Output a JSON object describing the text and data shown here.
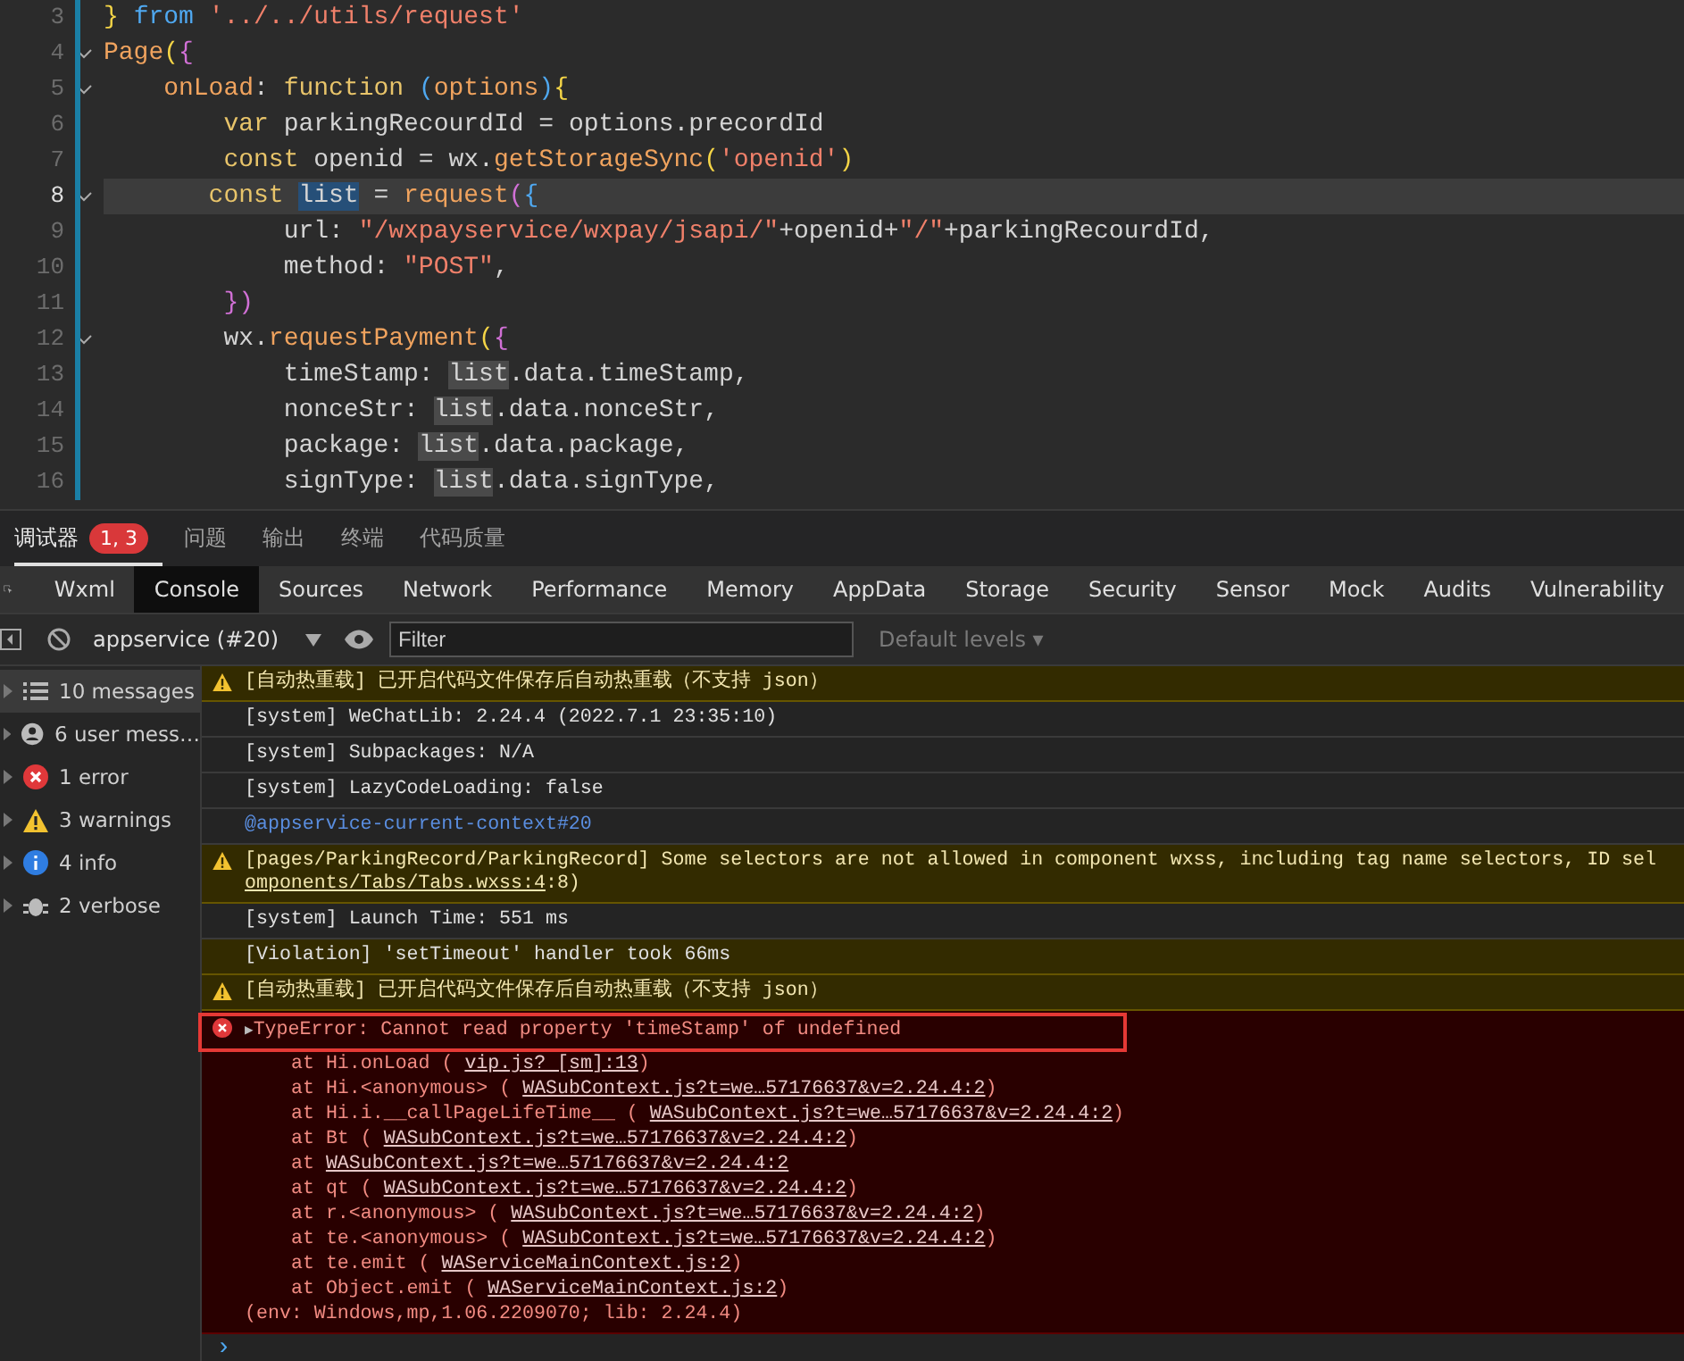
{
  "editor": {
    "lines": [
      {
        "num": "3",
        "fold": false,
        "current": false,
        "tokens": [
          {
            "t": "} ",
            "kind": "brace"
          },
          {
            "t": "from",
            "kind": "kw2"
          },
          {
            "t": " '../../utils/request'",
            "kind": "str"
          }
        ]
      },
      {
        "num": "4",
        "fold": true,
        "current": false,
        "tokens": [
          {
            "t": "Page",
            "kind": "fn"
          },
          {
            "t": "(",
            "kind": "brace"
          },
          {
            "t": "{",
            "kind": "brace2"
          }
        ]
      },
      {
        "num": "5",
        "fold": true,
        "current": false,
        "tokens": [
          {
            "t": "    onLoad",
            "kind": "fn"
          },
          {
            "t": ": ",
            "kind": "plain"
          },
          {
            "t": "function",
            "kind": "kw"
          },
          {
            "t": " (",
            "kind": "paren"
          },
          {
            "t": "options",
            "kind": "fn"
          },
          {
            "t": ")",
            "kind": "paren"
          },
          {
            "t": "{",
            "kind": "brace"
          }
        ]
      },
      {
        "num": "6",
        "fold": false,
        "current": false,
        "tokens": [
          {
            "t": "        var",
            "kind": "kw"
          },
          {
            "t": " parkingRecourdId = options.precordId",
            "kind": "plain"
          }
        ]
      },
      {
        "num": "7",
        "fold": false,
        "current": false,
        "tokens": [
          {
            "t": "        const",
            "kind": "kw"
          },
          {
            "t": " openid = wx.",
            "kind": "plain"
          },
          {
            "t": "getStorageSync",
            "kind": "fn"
          },
          {
            "t": "(",
            "kind": "brace"
          },
          {
            "t": "'openid'",
            "kind": "str"
          },
          {
            "t": ")",
            "kind": "brace"
          }
        ]
      },
      {
        "num": "8",
        "fold": true,
        "current": true,
        "tokens": [
          {
            "t": "       const ",
            "kind": "kw"
          },
          {
            "t": "list",
            "kind": "selected"
          },
          {
            "t": " = ",
            "kind": "plain"
          },
          {
            "t": "request",
            "kind": "fn"
          },
          {
            "t": "(",
            "kind": "brace2"
          },
          {
            "t": "{",
            "kind": "paren"
          }
        ]
      },
      {
        "num": "9",
        "fold": false,
        "current": false,
        "tokens": [
          {
            "t": "            url: ",
            "kind": "plain"
          },
          {
            "t": "\"/wxpayservice/wxpay/jsapi/\"",
            "kind": "str"
          },
          {
            "t": "+openid+",
            "kind": "plain"
          },
          {
            "t": "\"/\"",
            "kind": "str"
          },
          {
            "t": "+parkingRecourdId,",
            "kind": "plain"
          }
        ]
      },
      {
        "num": "10",
        "fold": false,
        "current": false,
        "tokens": [
          {
            "t": "            method: ",
            "kind": "plain"
          },
          {
            "t": "\"POST\"",
            "kind": "str"
          },
          {
            "t": ",",
            "kind": "plain"
          }
        ]
      },
      {
        "num": "11",
        "fold": false,
        "current": false,
        "tokens": [
          {
            "t": "        })",
            "kind": "brace2"
          }
        ]
      },
      {
        "num": "12",
        "fold": true,
        "current": false,
        "tokens": [
          {
            "t": "        wx.",
            "kind": "plain"
          },
          {
            "t": "requestPayment",
            "kind": "fn"
          },
          {
            "t": "(",
            "kind": "brace"
          },
          {
            "t": "{",
            "kind": "brace2"
          }
        ]
      },
      {
        "num": "13",
        "fold": false,
        "current": false,
        "tokens": [
          {
            "t": "            timeStamp: ",
            "kind": "plain"
          },
          {
            "t": "list",
            "kind": "match"
          },
          {
            "t": ".data.timeStamp,",
            "kind": "plain"
          }
        ]
      },
      {
        "num": "14",
        "fold": false,
        "current": false,
        "tokens": [
          {
            "t": "            nonceStr: ",
            "kind": "plain"
          },
          {
            "t": "list",
            "kind": "match"
          },
          {
            "t": ".data.nonceStr,",
            "kind": "plain"
          }
        ]
      },
      {
        "num": "15",
        "fold": false,
        "current": false,
        "tokens": [
          {
            "t": "            package: ",
            "kind": "plain"
          },
          {
            "t": "list",
            "kind": "match"
          },
          {
            "t": ".data.package,",
            "kind": "plain"
          }
        ]
      },
      {
        "num": "16",
        "fold": false,
        "current": false,
        "tokens": [
          {
            "t": "            signType: ",
            "kind": "plain"
          },
          {
            "t": "list",
            "kind": "match"
          },
          {
            "t": ".data.signType,",
            "kind": "plain"
          }
        ]
      }
    ]
  },
  "panel_tabs": [
    {
      "label": "调试器",
      "selected": true,
      "badge": "1, 3"
    },
    {
      "label": "问题",
      "selected": false
    },
    {
      "label": "输出",
      "selected": false
    },
    {
      "label": "终端",
      "selected": false
    },
    {
      "label": "代码质量",
      "selected": false
    }
  ],
  "devtools_tabs": [
    {
      "label": "Wxml",
      "selected": false
    },
    {
      "label": "Console",
      "selected": true
    },
    {
      "label": "Sources",
      "selected": false
    },
    {
      "label": "Network",
      "selected": false
    },
    {
      "label": "Performance",
      "selected": false
    },
    {
      "label": "Memory",
      "selected": false
    },
    {
      "label": "AppData",
      "selected": false
    },
    {
      "label": "Storage",
      "selected": false
    },
    {
      "label": "Security",
      "selected": false
    },
    {
      "label": "Sensor",
      "selected": false
    },
    {
      "label": "Mock",
      "selected": false
    },
    {
      "label": "Audits",
      "selected": false
    },
    {
      "label": "Vulnerability",
      "selected": false
    }
  ],
  "toolbar": {
    "context": "appservice (#20)",
    "filter": {
      "placeholder": "Filter"
    },
    "levels": "Default levels",
    "levels_arrow": "▾"
  },
  "sidebar": {
    "items": [
      {
        "kind": "list",
        "label": "10 messages",
        "selected": true
      },
      {
        "kind": "user",
        "label": "6 user mess…",
        "selected": false
      },
      {
        "kind": "error",
        "label": "1 error",
        "selected": false
      },
      {
        "kind": "warning",
        "label": "3 warnings",
        "selected": false
      },
      {
        "kind": "info",
        "label": "4 info",
        "selected": false
      },
      {
        "kind": "verbose",
        "label": "2 verbose",
        "selected": false
      }
    ]
  },
  "messages": [
    {
      "kind": "warning",
      "text": "[自动热重载] 已开启代码文件保存后自动热重载（不支持 json）"
    },
    {
      "kind": "log",
      "text": "[system] WeChatLib: 2.24.4 (2022.7.1 23:35:10)"
    },
    {
      "kind": "log",
      "text": "[system] Subpackages: N/A"
    },
    {
      "kind": "log",
      "text": "[system] LazyCodeLoading: false"
    },
    {
      "kind": "context",
      "text": "@appservice-current-context#20"
    },
    {
      "kind": "warning",
      "text": "[pages/ParkingRecord/ParkingRecord] Some selectors are not allowed in component wxss, including tag name selectors, ID sel",
      "link": "omponents/Tabs/Tabs.wxss:4",
      "after": ":8)"
    },
    {
      "kind": "log",
      "text": "[system] Launch Time: 551 ms"
    },
    {
      "kind": "violation",
      "text": "[Violation] 'setTimeout' handler took 66ms"
    },
    {
      "kind": "warning",
      "text": "[自动热重载] 已开启代码文件保存后自动热重载（不支持 json）"
    }
  ],
  "error": {
    "toggle": "▶",
    "message": "TypeError: Cannot read property 'timeStamp' of undefined",
    "frames": [
      {
        "at": "at Hi.onLoad (",
        "link": "vip.js? [sm]:13",
        "after": ")"
      },
      {
        "at": "at Hi.<anonymous> (",
        "link": "WASubContext.js?t=we…57176637&v=2.24.4:2",
        "after": ")"
      },
      {
        "at": "at Hi.i.__callPageLifeTime__ (",
        "link": "WASubContext.js?t=we…57176637&v=2.24.4:2",
        "after": ")"
      },
      {
        "at": "at Bt (",
        "link": "WASubContext.js?t=we…57176637&v=2.24.4:2",
        "after": ")"
      },
      {
        "at": "at",
        "link": "WASubContext.js?t=we…57176637&v=2.24.4:2"
      },
      {
        "at": "at qt (",
        "link": "WASubContext.js?t=we…57176637&v=2.24.4:2",
        "after": ")"
      },
      {
        "at": "at r.<anonymous> (",
        "link": "WASubContext.js?t=we…57176637&v=2.24.4:2",
        "after": ")"
      },
      {
        "at": "at te.<anonymous> (",
        "link": "WASubContext.js?t=we…57176637&v=2.24.4:2",
        "after": ")"
      },
      {
        "at": "at te.emit (",
        "link": "WAServiceMainContext.js:2",
        "after": ")"
      },
      {
        "at": "at Object.emit (",
        "link": "WAServiceMainContext.js:2",
        "after": ")"
      }
    ],
    "env": "(env: Windows,mp,1.06.2209070; lib: 2.24.4)"
  },
  "prompt": "›"
}
